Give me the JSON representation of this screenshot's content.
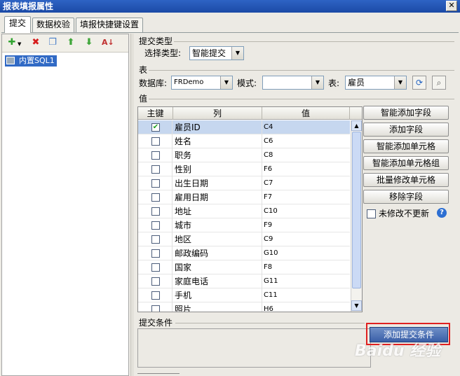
{
  "window": {
    "title": "报表填报属性"
  },
  "tabs": [
    {
      "label": "提交",
      "active": true
    },
    {
      "label": "数据校验",
      "active": false
    },
    {
      "label": "填报快捷键设置",
      "active": false
    }
  ],
  "toolbar_icons": [
    "add-icon",
    "delete-icon",
    "copy-icon",
    "move-up-icon",
    "move-down-icon",
    "sort-icon"
  ],
  "tree": {
    "items": [
      {
        "label": "内置SQL1",
        "selected": true
      }
    ]
  },
  "submit_type": {
    "section_label": "提交类型",
    "select_label": "选择类型:",
    "value": "智能提交"
  },
  "table_section": {
    "section_label": "表",
    "db_label": "数据库:",
    "db_value": "FRDemo",
    "mode_label": "模式:",
    "mode_value": "",
    "table_label": "表:",
    "table_value": "雇员"
  },
  "values_section": {
    "section_label": "值",
    "headers": [
      "主键",
      "列",
      "值"
    ],
    "rows": [
      {
        "key": true,
        "column": "雇员ID",
        "value": "C4",
        "selected": true
      },
      {
        "key": false,
        "column": "姓名",
        "value": "C6"
      },
      {
        "key": false,
        "column": "职务",
        "value": "C8"
      },
      {
        "key": false,
        "column": "性别",
        "value": "F6"
      },
      {
        "key": false,
        "column": "出生日期",
        "value": "C7"
      },
      {
        "key": false,
        "column": "雇用日期",
        "value": "F7"
      },
      {
        "key": false,
        "column": "地址",
        "value": "C10"
      },
      {
        "key": false,
        "column": "城市",
        "value": "F9"
      },
      {
        "key": false,
        "column": "地区",
        "value": "C9"
      },
      {
        "key": false,
        "column": "邮政编码",
        "value": "G10"
      },
      {
        "key": false,
        "column": "国家",
        "value": "F8"
      },
      {
        "key": false,
        "column": "家庭电话",
        "value": "G11"
      },
      {
        "key": false,
        "column": "手机",
        "value": "C11"
      },
      {
        "key": false,
        "column": "照片",
        "value": "H6"
      }
    ]
  },
  "right_buttons": {
    "smart_add_field": "智能添加字段",
    "add_field": "添加字段",
    "smart_add_cell": "智能添加单元格",
    "smart_add_cell_group": "智能添加单元格组",
    "batch_modify_cell": "批量修改单元格",
    "remove_field": "移除字段"
  },
  "no_update_unmodified": {
    "label": "未修改不更新",
    "checked": false
  },
  "submit_condition": {
    "section_label": "提交条件",
    "add_button": "添加提交条件"
  },
  "watermark": "Baidu 经验",
  "colors": {
    "titlebar": "#1b4aa6",
    "selection": "#316ac5",
    "highlight_box": "#e02020"
  }
}
